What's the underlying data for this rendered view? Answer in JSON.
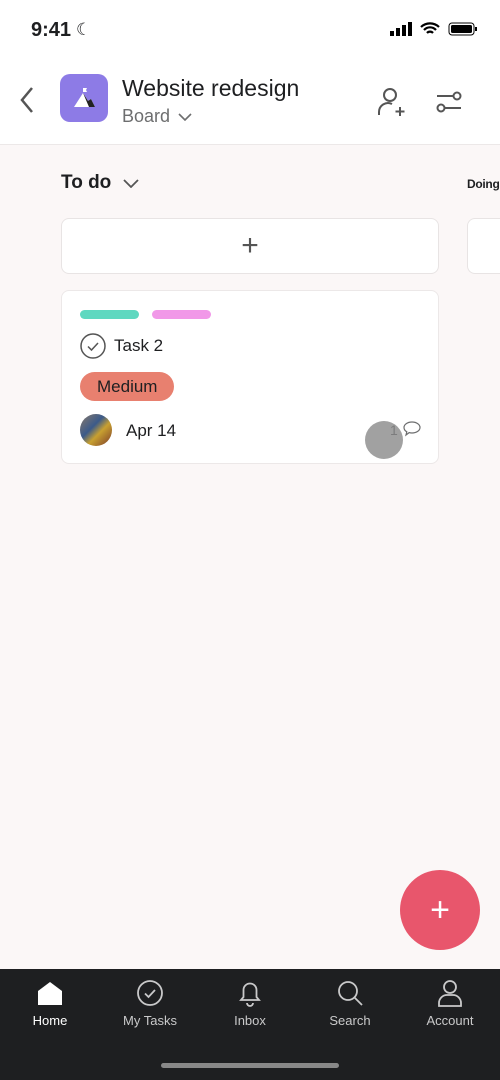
{
  "status": {
    "time": "9:41"
  },
  "header": {
    "title": "Website redesign",
    "view": "Board"
  },
  "board": {
    "columns": [
      {
        "title": "To do",
        "add_label": "+"
      },
      {
        "title": "Doing"
      }
    ],
    "card": {
      "title": "Task 2",
      "tag_colors": [
        "#5fd8c0",
        "#f198e8"
      ],
      "priority": "Medium",
      "priority_color": "#e8806f",
      "date": "Apr 14",
      "comments": "1"
    }
  },
  "fab": {
    "label": "+"
  },
  "tabs": [
    {
      "label": "Home",
      "icon": "home-icon"
    },
    {
      "label": "My Tasks",
      "icon": "check-circle-icon"
    },
    {
      "label": "Inbox",
      "icon": "bell-icon"
    },
    {
      "label": "Search",
      "icon": "search-icon"
    },
    {
      "label": "Account",
      "icon": "person-icon"
    }
  ]
}
